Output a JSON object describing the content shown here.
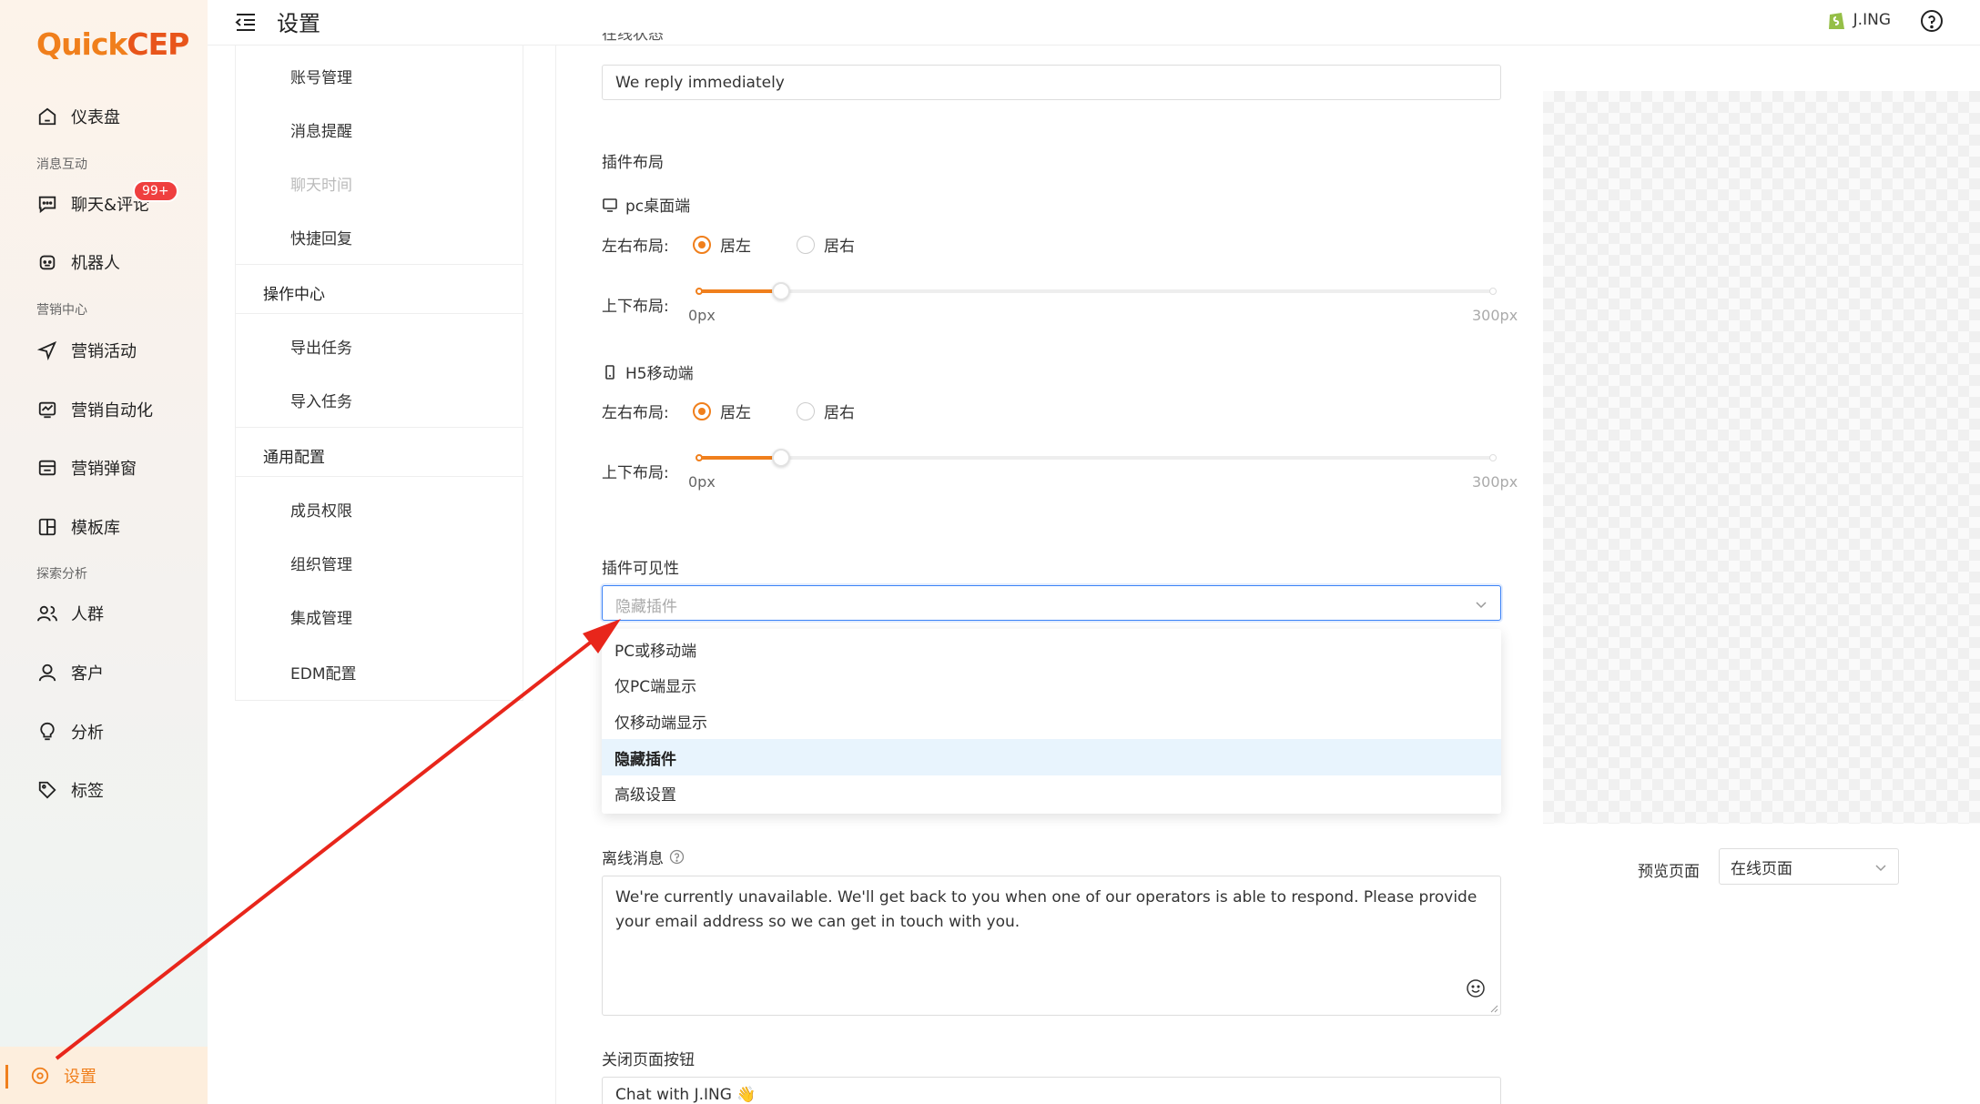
{
  "brand": {
    "logo_q": "Q",
    "logo_uick": "uick",
    "logo_cep": "CEP",
    "accent": "#f07f1c"
  },
  "nav": {
    "dashboard": "仪表盘",
    "section_messaging": "消息互动",
    "chat": "聊天&评论",
    "chat_badge": "99+",
    "robot": "机器人",
    "section_marketing": "营销中心",
    "campaign": "营销活动",
    "automation": "营销自动化",
    "popup": "营销弹窗",
    "templates": "模板库",
    "section_analysis": "探索分析",
    "audience": "人群",
    "customer": "客户",
    "analysis": "分析",
    "tags": "标签",
    "settings": "设置"
  },
  "topbar": {
    "title": "设置",
    "user": "J.ING"
  },
  "submenu": {
    "account": "账号管理",
    "notify": "消息提醒",
    "chat_time": "聊天时间",
    "quick_reply": "快捷回复",
    "group_ops": "操作中心",
    "export": "导出任务",
    "import": "导入任务",
    "group_general": "通用配置",
    "members": "成员权限",
    "org": "组织管理",
    "integration": "集成管理",
    "edm": "EDM配置"
  },
  "form": {
    "online_status_label": "在线状态",
    "online_status_value": "We reply immediately",
    "layout_title": "插件布局",
    "pc_title": "pc桌面端",
    "h5_title": "H5移动端",
    "lr_label": "左右布局:",
    "left_option": "居左",
    "right_option": "居右",
    "ud_label": "上下布局:",
    "slider_min": "0px",
    "slider_max": "300px",
    "pc_layout": "居左",
    "h5_layout": "居左",
    "pc_offset_fraction": 0.11,
    "h5_offset_fraction": 0.11,
    "visibility_label": "插件可见性",
    "visibility_value": "隐藏插件",
    "visibility_options": [
      "PC或移动端",
      "仅PC端显示",
      "仅移动端显示",
      "隐藏插件",
      "高级设置"
    ],
    "offline_label": "离线消息",
    "offline_value": "We're currently unavailable. We'll get back to you when one of our operators is able to respond. Please provide your email address so we can get in touch with you.",
    "close_btn_label": "关闭页面按钮",
    "close_btn_value": "Chat with J.ING 👋"
  },
  "preview": {
    "label": "预览页面",
    "value": "在线页面"
  },
  "icons": {
    "menu": "menu-fold-icon",
    "help": "question-circle-icon",
    "shop": "shopify-icon",
    "desktop": "desktop-icon",
    "mobile": "mobile-icon",
    "chevron": "chevron-down-icon",
    "info": "question-circle-icon",
    "emoji": "smile-icon",
    "arrow": "red-annotation-arrow"
  }
}
